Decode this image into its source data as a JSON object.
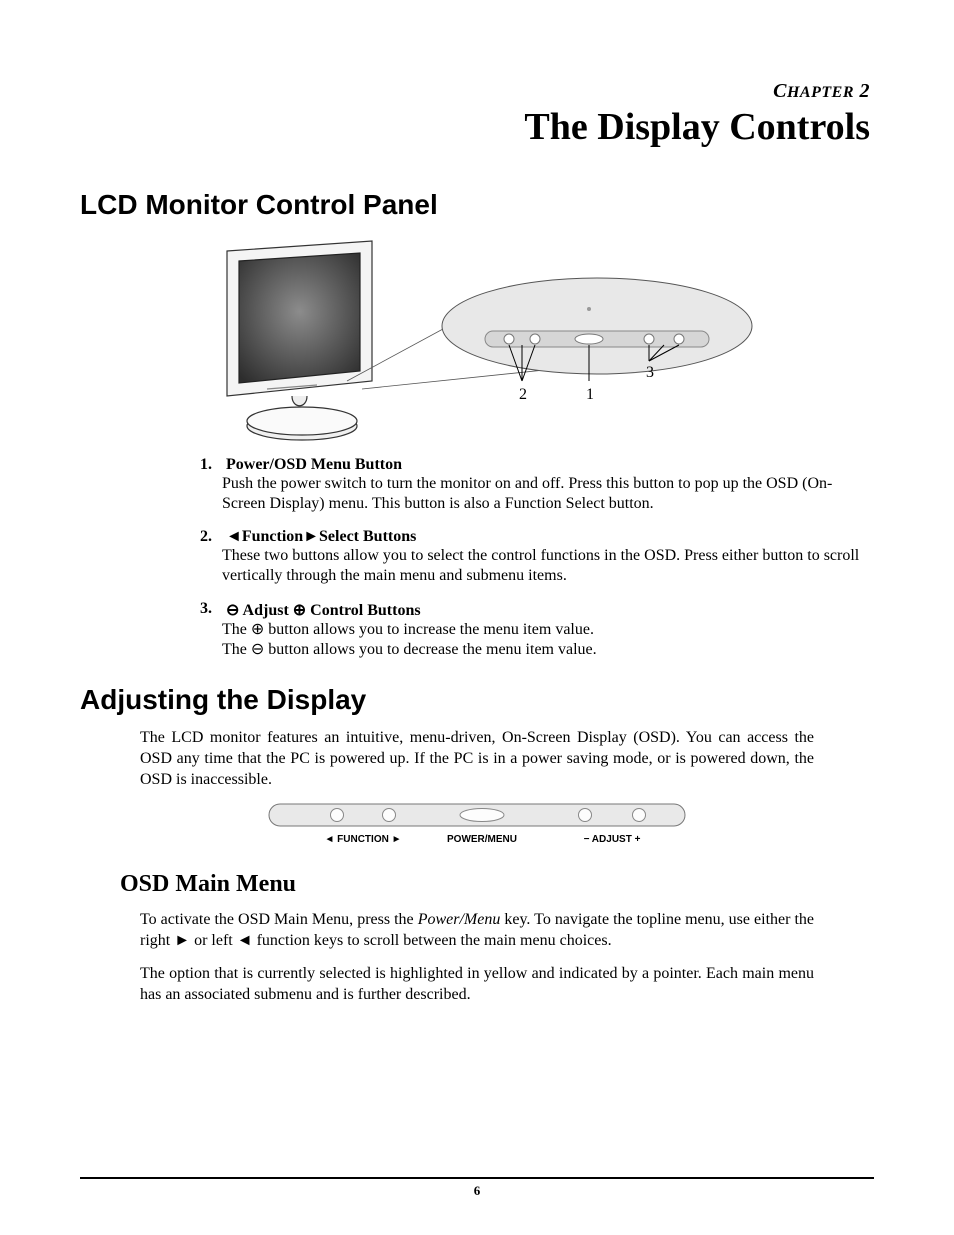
{
  "chapter": {
    "label_prefix": "C",
    "label_word": "HAPTER",
    "number": " 2",
    "title": "The Display Controls"
  },
  "sections": {
    "s1_title": "LCD Monitor Control Panel",
    "s2_title": "Adjusting the Display",
    "s3_title": "OSD Main Menu"
  },
  "figure1": {
    "callouts": {
      "c1": "1",
      "c2": "2",
      "c3": "3"
    }
  },
  "list": {
    "i1": {
      "num": "1.",
      "head": "Power/OSD Menu Button",
      "body": "Push the power switch to turn the monitor on and off.  Press this button to pop up the OSD (On-Screen Display) menu. This button is also a Function Select button."
    },
    "i2": {
      "num": "2.",
      "tri_l": "◄",
      "head_word": "Function",
      "tri_r": "►",
      "head_tail": "Select Buttons",
      "body": "These two buttons allow you to select the control functions in the OSD.  Press either button to scroll vertically through the main menu and submenu items."
    },
    "i3": {
      "num": "3.",
      "sym_minus": "⊖",
      "head_word": "Adjust",
      "sym_plus": "⊕",
      "head_tail": " Control Buttons",
      "line1a": "The ",
      "line1b": " button allows you to increase the menu item value.",
      "line2a": "The ",
      "line2b": " button allows you to decrease the menu item value."
    }
  },
  "adjusting_para": "The LCD monitor features an intuitive, menu-driven, On-Screen Display (OSD). You can access the OSD any time that the PC is powered up. If the PC is in a power saving mode, or is powered down, the OSD is inaccessible.",
  "button_bar": {
    "left": "◄ FUNCTION ►",
    "center": "POWER/MENU",
    "right": "− ADJUST +"
  },
  "osd_p1_a": "To activate the OSD Main Menu, press the ",
  "osd_p1_em": "Power/Menu",
  "osd_p1_b": " key. To navigate the topline menu, use either the right ",
  "osd_p1_tr": "►",
  "osd_p1_c": " or left ",
  "osd_p1_tl": "◄",
  "osd_p1_d": " function keys to scroll between the main menu choices.",
  "osd_p2": "The option that is currently selected is highlighted in yellow and indicated by a pointer.  Each main menu has an associated submenu and is further described.",
  "page_number": "6"
}
